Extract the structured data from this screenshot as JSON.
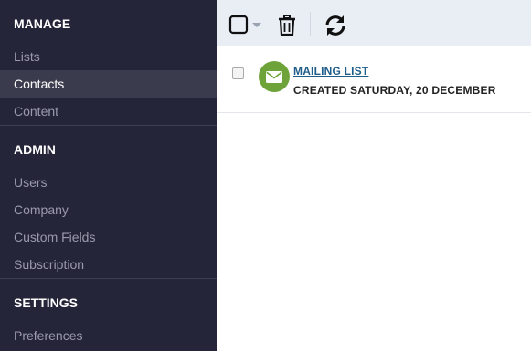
{
  "sidebar": {
    "manage": {
      "heading": "MANAGE",
      "items": [
        {
          "label": "Lists"
        },
        {
          "label": "Contacts"
        },
        {
          "label": "Content"
        }
      ]
    },
    "admin": {
      "heading": "ADMIN",
      "items": [
        {
          "label": "Users"
        },
        {
          "label": "Company"
        },
        {
          "label": "Custom Fields"
        },
        {
          "label": "Subscription"
        }
      ]
    },
    "settings": {
      "heading": "SETTINGS",
      "items": [
        {
          "label": "Preferences"
        }
      ]
    },
    "active_item": "Contacts"
  },
  "toolbar": {
    "icons": [
      "select-all-checkbox-icon",
      "dropdown-caret-icon",
      "trash-icon",
      "refresh-icon"
    ]
  },
  "list": {
    "rows": [
      {
        "icon": "envelope-icon",
        "title": "MAILING LIST",
        "meta": "CREATED SATURDAY, 20 DECEMBER"
      }
    ]
  },
  "colors": {
    "sidebar_bg": "#25253a",
    "sidebar_active_bg": "#3b3b4e",
    "toolbar_bg": "#e9edf4",
    "avatar_green": "#6ea33a",
    "link_blue": "#1f5d8a"
  }
}
